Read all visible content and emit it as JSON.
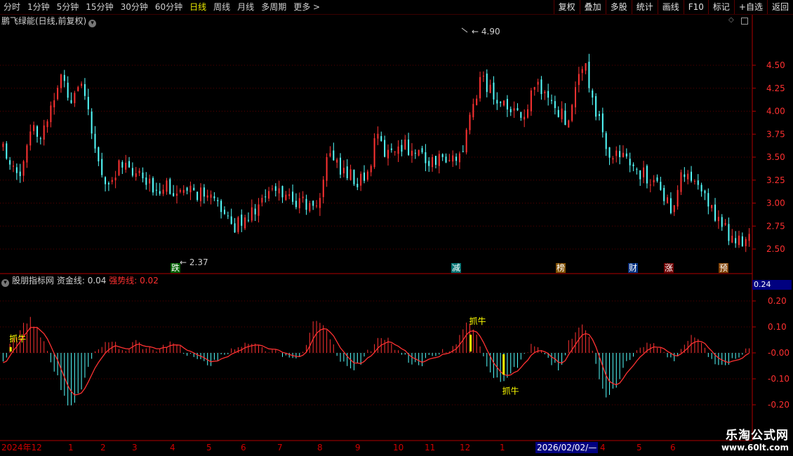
{
  "toolbar": {
    "periods": [
      "分时",
      "1分钟",
      "5分钟",
      "15分钟",
      "30分钟",
      "60分钟",
      "日线",
      "周线",
      "月线",
      "多周期",
      "更多 >"
    ],
    "active_index": 6,
    "actions": [
      "复权",
      "叠加",
      "多股",
      "统计",
      "画线",
      "F10",
      "标记",
      "+自选",
      "返回"
    ]
  },
  "main": {
    "title": "鹏飞绿能(日线,前复权)",
    "price_ticks": [
      "4.50",
      "4.25",
      "4.00",
      "3.75",
      "3.50",
      "3.25",
      "3.00",
      "2.75",
      "2.50"
    ],
    "high_label": "4.90",
    "low_label": "2.37",
    "markers": [
      "跌",
      "减",
      "榜",
      "财",
      "涨",
      "预"
    ]
  },
  "indicator": {
    "name": "股朋指标网",
    "fund_label": "资金线: 0.04",
    "strong_label": "强势线: 0.02",
    "value_box": "0.24",
    "ticks": [
      "0.20",
      "0.10",
      "-0.00",
      "-0.10",
      "-0.20"
    ],
    "signals": [
      "抓牛",
      "抓牛",
      "抓牛"
    ]
  },
  "date_axis": [
    "2024年12",
    "1",
    "2",
    "3",
    "4",
    "5",
    "6",
    "7",
    "8",
    "9",
    "10",
    "11",
    "12",
    "1",
    "2026/02/02/—",
    "4",
    "5",
    "6"
  ],
  "watermark": {
    "line1": "乐淘公式网",
    "line2": "www.60lt.com"
  },
  "colors": {
    "up": "#ff3232",
    "down": "#54ffff",
    "axis": "#b00000",
    "grid": "#5a0000",
    "signal": "#ffff00"
  },
  "chart_data": [
    {
      "type": "candlestick",
      "title": "鹏飞绿能(日线,前复权)",
      "ylim": [
        2.37,
        4.9
      ],
      "y_ticks": [
        2.5,
        2.75,
        3.0,
        3.25,
        3.5,
        3.75,
        4.0,
        4.25,
        4.5
      ],
      "annotations": [
        {
          "label": "4.90",
          "type": "high"
        },
        {
          "label": "2.37",
          "type": "low"
        }
      ],
      "close_path": [
        3.6,
        3.45,
        3.3,
        3.95,
        3.7,
        4.05,
        4.4,
        4.15,
        4.3,
        3.9,
        3.4,
        3.2,
        3.4,
        3.35,
        3.3,
        3.2,
        3.15,
        3.25,
        3.1,
        3.05,
        3.15,
        3.05,
        3.0,
        2.95,
        2.7,
        2.85,
        2.9,
        3.0,
        3.1,
        3.15,
        3.05,
        3.0,
        2.95,
        3.0,
        3.6,
        3.4,
        3.3,
        3.25,
        3.3,
        3.7,
        3.55,
        3.6,
        3.65,
        3.55,
        3.5,
        3.45,
        3.55,
        3.45,
        3.55,
        4.0,
        4.4,
        4.2,
        4.1,
        4.0,
        3.9,
        4.1,
        4.3,
        4.15,
        4.0,
        3.9,
        4.4,
        4.45,
        4.0,
        3.6,
        3.5,
        3.45,
        3.4,
        3.3,
        3.2,
        3.1,
        2.95,
        3.35,
        3.2,
        3.1,
        2.95,
        2.8,
        2.65,
        2.55,
        2.6
      ],
      "candles_visible": 220
    },
    {
      "type": "bar",
      "title": "股朋指标网",
      "ylim": [
        -0.25,
        0.25
      ],
      "y_ticks": [
        0.2,
        0.1,
        0.0,
        -0.1,
        -0.2
      ],
      "series": [
        {
          "name": "资金线",
          "last": 0.04
        },
        {
          "name": "强势线",
          "last": 0.02
        }
      ],
      "oscillator_path": [
        -0.04,
        0.05,
        0.1,
        0.13,
        0.06,
        -0.02,
        -0.12,
        -0.21,
        -0.16,
        -0.06,
        0.02,
        0.05,
        0.03,
        0.01,
        0.04,
        0.02,
        0.01,
        0.03,
        0.04,
        0.01,
        -0.01,
        -0.03,
        -0.05,
        -0.02,
        0.01,
        0.03,
        0.04,
        0.02,
        0.01,
        0.0,
        -0.02,
        -0.03,
        0.02,
        0.14,
        0.1,
        0.02,
        -0.04,
        -0.06,
        -0.03,
        0.02,
        0.07,
        0.04,
        0.0,
        -0.03,
        -0.05,
        -0.02,
        0.0,
        0.01,
        0.04,
        0.12,
        0.08,
        -0.03,
        -0.09,
        -0.12,
        -0.07,
        -0.02,
        0.04,
        0.01,
        -0.04,
        -0.06,
        0.05,
        0.11,
        0.07,
        -0.08,
        -0.18,
        -0.12,
        -0.04,
        0.01,
        0.04,
        0.03,
        0.0,
        -0.03,
        0.02,
        0.07,
        0.03,
        -0.02,
        -0.05,
        -0.03,
        -0.01,
        0.03
      ],
      "signals": [
        {
          "label": "抓牛",
          "position": 0.8
        },
        {
          "label": "抓牛",
          "position": 49.5
        },
        {
          "label": "抓牛",
          "position": 53.0
        }
      ]
    }
  ]
}
